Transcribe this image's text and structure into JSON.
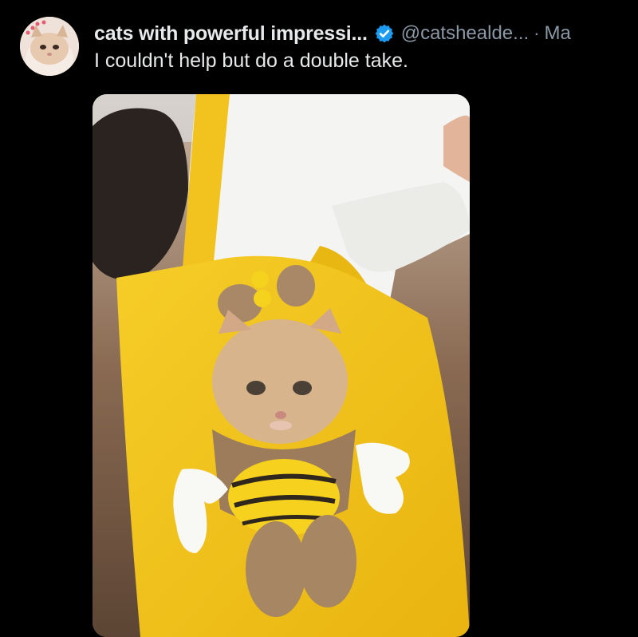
{
  "tweet": {
    "display_name": "cats with powerful impressi...",
    "handle": "@catshealde...",
    "separator": "·",
    "date": "Ma",
    "text": "I couldn't help but do a double take.",
    "verified_icon": "verified-badge-icon",
    "verified_color": "#1d9bf0"
  },
  "media": {
    "kind": "video-still",
    "subject": "cat-in-bee-costume-tote-bag",
    "colors": {
      "bag": "#f2c21e",
      "shirt": "#f4f4f2",
      "hair": "#2b2320"
    }
  }
}
